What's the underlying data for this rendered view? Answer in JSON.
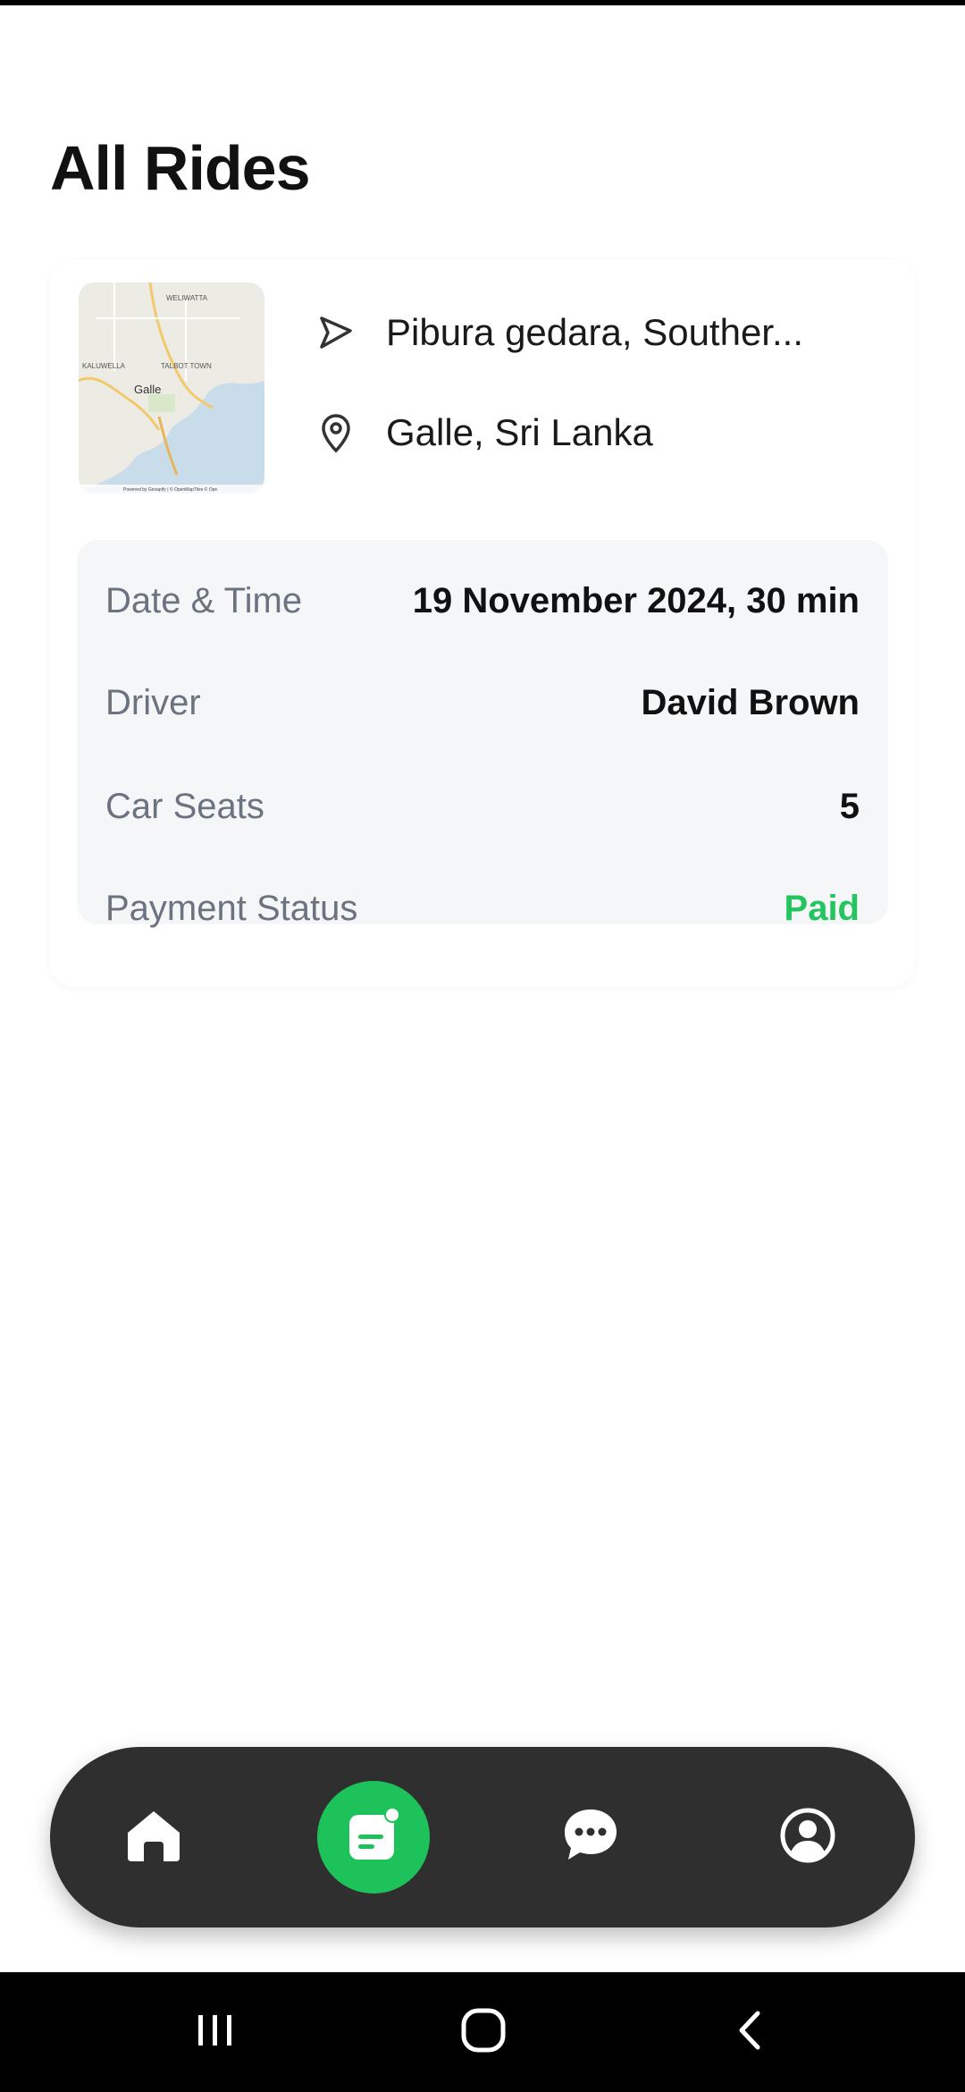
{
  "page": {
    "title": "All Rides"
  },
  "ride": {
    "from": "Pibura gedara, Souther...",
    "to": "Galle, Sri Lanka",
    "map": {
      "labels": [
        "WELIWATTA",
        "KALUWELLA",
        "TALBOT TOWN",
        "Galle"
      ],
      "attribution": "Powered by Geoapify | © OpenMapTiles © Ope"
    },
    "details": [
      {
        "label": "Date & Time",
        "value": "19 November 2024, 30 min"
      },
      {
        "label": "Driver",
        "value": "David Brown"
      },
      {
        "label": "Car Seats",
        "value": "5"
      },
      {
        "label": "Payment Status",
        "value": "Paid"
      }
    ]
  },
  "nav": {
    "items": [
      {
        "icon": "home-icon"
      },
      {
        "icon": "rides-icon",
        "active": true
      },
      {
        "icon": "chat-icon"
      },
      {
        "icon": "profile-icon"
      }
    ]
  },
  "colors": {
    "accent": "#1ec25a",
    "paid": "#22c55e",
    "nav_bg": "#2f2f2f",
    "details_bg": "#f5f6f8"
  }
}
